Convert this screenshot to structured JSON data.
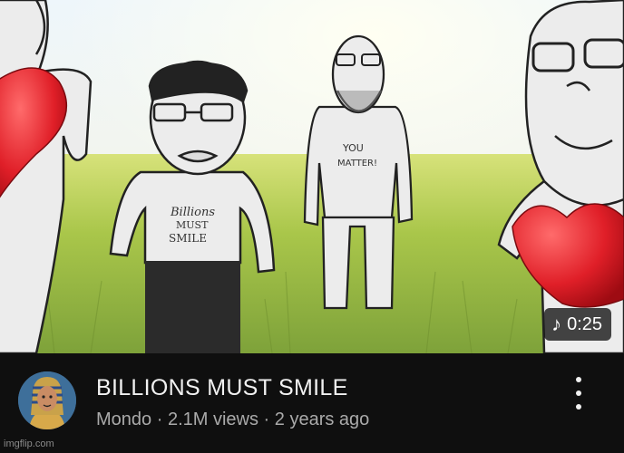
{
  "video": {
    "duration": "0:25",
    "title": "BILLIONS MUST SMILE",
    "channel": "Mondo",
    "views": "2.1M views",
    "age": "2 years ago",
    "separator": "·"
  },
  "thumbnail": {
    "shirt_text_left": [
      "Billions",
      "MUST",
      "SMILE"
    ],
    "shirt_text_center": [
      "YOU",
      "MATTER!"
    ]
  },
  "icons": {
    "duration": "music-note-icon",
    "menu": "more-vertical-icon"
  },
  "watermark": "imgflip.com"
}
